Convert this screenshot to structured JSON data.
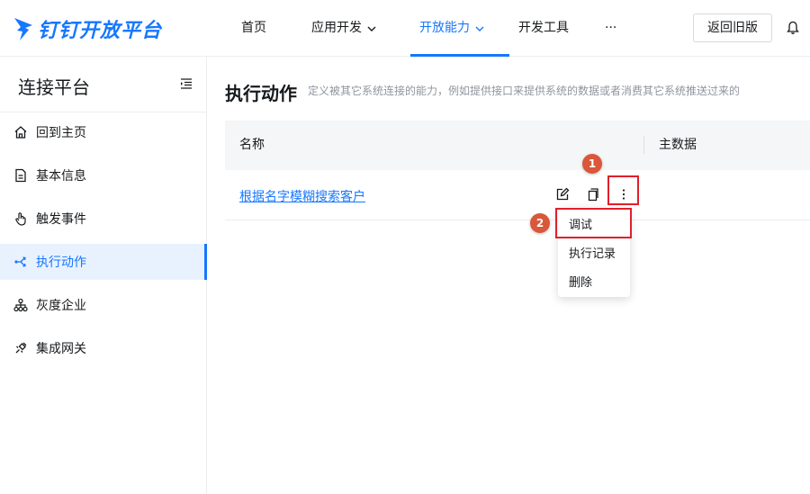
{
  "brand": {
    "logo_text": "钉钉开放平台",
    "accent": "#1677ff"
  },
  "nav": {
    "items": [
      {
        "label": "首页"
      },
      {
        "label": "应用开发"
      },
      {
        "label": "开放能力"
      },
      {
        "label": "开发工具"
      },
      {
        "label": "···"
      }
    ],
    "active": "开放能力",
    "back_label": "返回旧版"
  },
  "sidebar": {
    "title": "连接平台",
    "items": [
      {
        "label": "回到主页",
        "icon": "home-icon"
      },
      {
        "label": "基本信息",
        "icon": "document-icon"
      },
      {
        "label": "触发事件",
        "icon": "tap-icon"
      },
      {
        "label": "执行动作",
        "icon": "branch-icon",
        "active": true
      },
      {
        "label": "灰度企业",
        "icon": "org-icon"
      },
      {
        "label": "集成网关",
        "icon": "plug-icon"
      }
    ]
  },
  "main": {
    "title": "执行动作",
    "description": "定义被其它系统连接的能力，例如提供接口来提供系统的数据或者消费其它系统推送过来的",
    "columns": [
      "名称",
      "主数据"
    ],
    "rows": [
      {
        "name": "根据名字模糊搜索客户"
      }
    ]
  },
  "dropdown": {
    "items": [
      "调试",
      "执行记录",
      "删除"
    ]
  },
  "annotations": {
    "badge_1": "1",
    "badge_2": "2",
    "color": "#e0202a"
  }
}
